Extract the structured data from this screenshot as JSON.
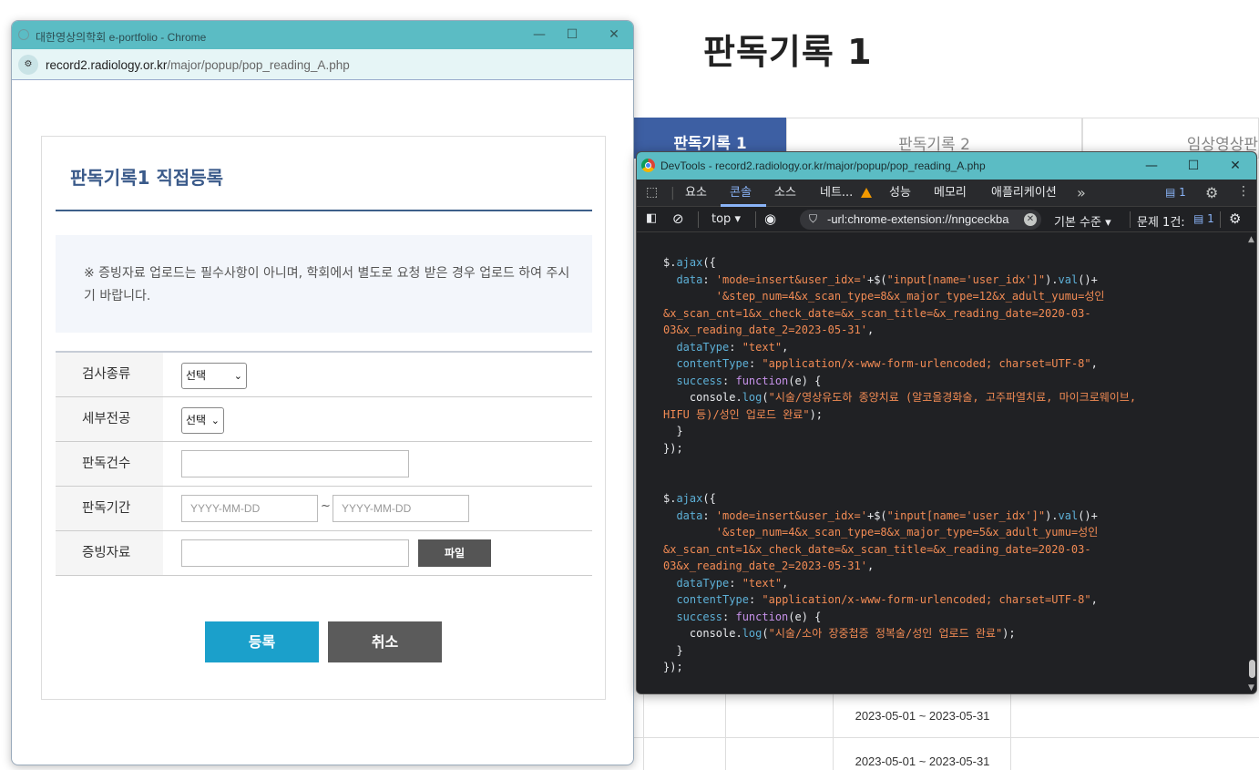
{
  "background_page": {
    "title": "판독기록 1",
    "tabs": [
      "판독기록 1",
      "판독기록 2",
      "임상영상판"
    ],
    "table_rows": [
      {
        "period": "2023-05-01 ~ 2023-05-31"
      },
      {
        "period": "2023-05-01 ~ 2023-05-31"
      }
    ]
  },
  "popup": {
    "window_title": "대한영상의학회 e-portfolio - Chrome",
    "url_host": "record2.radiology.or.kr",
    "url_path": "/major/popup/pop_reading_A.php",
    "controls": {
      "minimize": "—",
      "maximize": "☐",
      "close": "✕"
    },
    "form": {
      "title": "판독기록1 직접등록",
      "notice": "※ 증빙자료 업로드는 필수사항이 아니며, 학회에서 별도로 요청 받은 경우 업로드 하여 주시기 바랍니다.",
      "rows": {
        "exam_type": {
          "label": "검사종류",
          "selected": "선택"
        },
        "sub_specialty": {
          "label": "세부전공",
          "selected": "선택"
        },
        "reading_count": {
          "label": "판독건수",
          "value": ""
        },
        "reading_period": {
          "label": "판독기간",
          "start_placeholder": "YYYY-MM-DD",
          "separator": "~",
          "end_placeholder": "YYYY-MM-DD"
        },
        "evidence": {
          "label": "증빙자료",
          "value": "",
          "file_button": "파일"
        }
      },
      "register_button": "등록",
      "cancel_button": "취소"
    }
  },
  "devtools": {
    "window_title": "DevTools - record2.radiology.or.kr/major/popup/pop_reading_A.php",
    "tabs": [
      "요소",
      "콘솔",
      "소스",
      "네트...",
      "성능",
      "메모리",
      "애플리케이션"
    ],
    "active_tab": "콘솔",
    "issues_badge": "1",
    "toolbar": {
      "context": "top",
      "filter": "-url:chrome-extension://nngceckba",
      "level": "기본 수준",
      "issues_label": "문제 1건:",
      "issues_count": "1"
    },
    "code_block_1": {
      "msg": "시술/영상유도하 종양치료 (알코올경화술, 고주파열치료, 마이크로웨이브, HIFU 등)/성인 업로드 완료",
      "major_type": "12"
    },
    "code_block_2": {
      "msg": "시술/소아 장중첩증 정복술/성인 업로드 완료",
      "major_type": "5"
    }
  }
}
